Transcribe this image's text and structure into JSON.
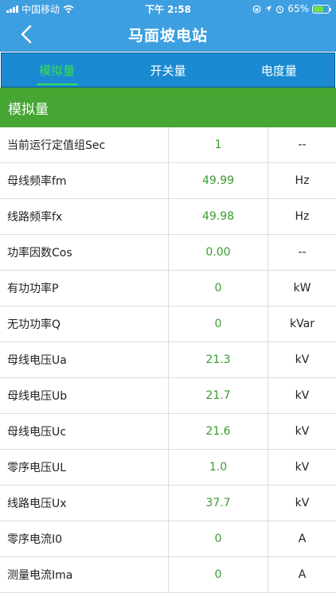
{
  "status": {
    "carrier": "中国移动",
    "time": "下午 2:58",
    "battery": "65%",
    "battery_level": 0.65
  },
  "nav": {
    "title": "马面坡电站"
  },
  "tabs": [
    {
      "label": "模拟量",
      "active": true
    },
    {
      "label": "开关量",
      "active": false
    },
    {
      "label": "电度量",
      "active": false
    }
  ],
  "section": {
    "title": "模拟量"
  },
  "rows": [
    {
      "name": "当前运行定值组Sec",
      "value": "1",
      "unit": "--"
    },
    {
      "name": "母线频率fm",
      "value": "49.99",
      "unit": "Hz"
    },
    {
      "name": "线路频率fx",
      "value": "49.98",
      "unit": "Hz"
    },
    {
      "name": "功率因数Cos",
      "value": "0.00",
      "unit": "--"
    },
    {
      "name": "有功功率P",
      "value": "0",
      "unit": "kW"
    },
    {
      "name": "无功功率Q",
      "value": "0",
      "unit": "kVar"
    },
    {
      "name": "母线电压Ua",
      "value": "21.3",
      "unit": "kV"
    },
    {
      "name": "母线电压Ub",
      "value": "21.7",
      "unit": "kV"
    },
    {
      "name": "母线电压Uc",
      "value": "21.6",
      "unit": "kV"
    },
    {
      "name": "零序电压UL",
      "value": "1.0",
      "unit": "kV"
    },
    {
      "name": "线路电压Ux",
      "value": "37.7",
      "unit": "kV"
    },
    {
      "name": "零序电流I0",
      "value": "0",
      "unit": "A"
    },
    {
      "name": "测量电流Ima",
      "value": "0",
      "unit": "A"
    }
  ],
  "colors": {
    "nav_bg": "#3d9fe0",
    "tab_bg": "#1b8ad2",
    "tab_active": "#37e04b",
    "section_bg": "#45a633",
    "value_text": "#3a9b2e"
  }
}
